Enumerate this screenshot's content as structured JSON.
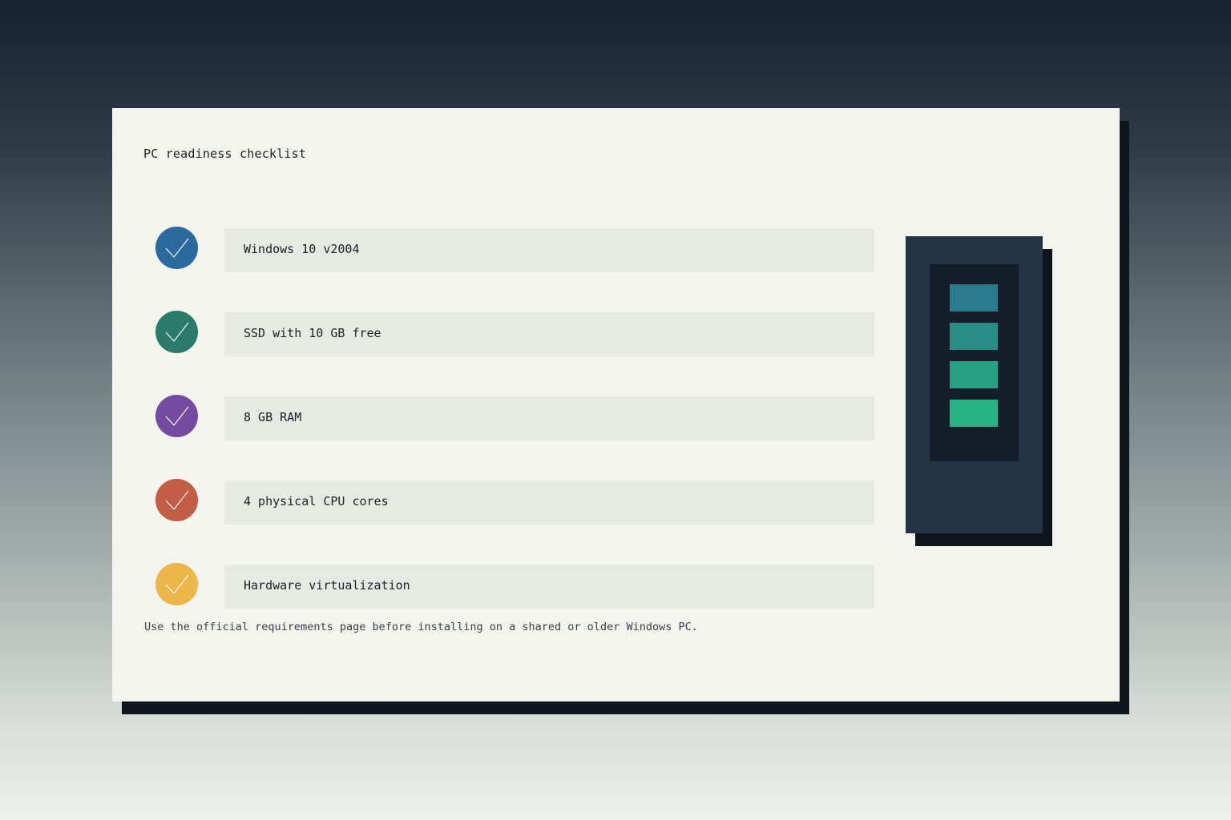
{
  "title": "PC readiness checklist",
  "items": [
    {
      "label": "Windows 10 v2004",
      "icon": "check-icon",
      "color": "#2c6a9e"
    },
    {
      "label": "SSD with 10 GB free",
      "icon": "check-icon",
      "color": "#2a7b6a"
    },
    {
      "label": "8 GB RAM",
      "icon": "check-icon",
      "color": "#744ba0"
    },
    {
      "label": "4 physical CPU cores",
      "icon": "check-icon",
      "color": "#c25d46"
    },
    {
      "label": "Hardware virtualization",
      "icon": "check-icon",
      "color": "#ecb64a"
    }
  ],
  "footnote": "Use the official requirements page before installing on a shared or older Windows PC.",
  "device": {
    "icon": "pc-tower-icon",
    "body_color": "#243444",
    "screen_color": "#151d28",
    "bar_colors": [
      "#2a7c8c",
      "#2a8c86",
      "#27a084",
      "#27b484"
    ]
  }
}
